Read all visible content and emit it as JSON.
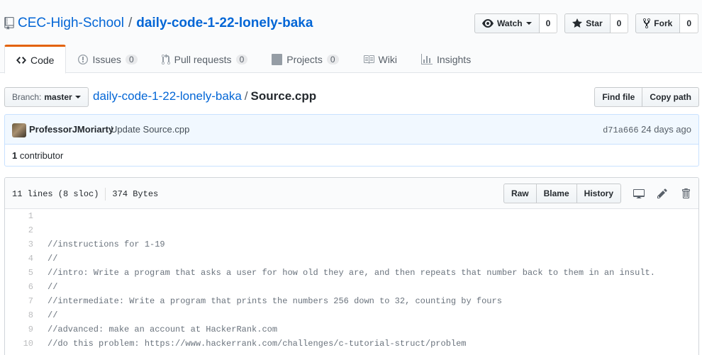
{
  "repo": {
    "owner": "CEC-High-School",
    "separator": "/",
    "name": "daily-code-1-22-lonely-baka"
  },
  "actions": {
    "watch": {
      "label": "Watch",
      "count": "0"
    },
    "star": {
      "label": "Star",
      "count": "0"
    },
    "fork": {
      "label": "Fork",
      "count": "0"
    }
  },
  "tabs": [
    {
      "label": "Code"
    },
    {
      "label": "Issues",
      "count": "0"
    },
    {
      "label": "Pull requests",
      "count": "0"
    },
    {
      "label": "Projects",
      "count": "0"
    },
    {
      "label": "Wiki"
    },
    {
      "label": "Insights"
    }
  ],
  "branch": {
    "prefix": "Branch:",
    "name": "master"
  },
  "breadcrumb": {
    "root": "daily-code-1-22-lonely-baka",
    "separator": "/",
    "file": "Source.cpp"
  },
  "file_nav": {
    "find_file": "Find file",
    "copy_path": "Copy path"
  },
  "commit": {
    "author": "ProfessorJMoriarty",
    "message": "Update Source.cpp",
    "sha": "d71a666",
    "age": "24 days ago"
  },
  "contributors": {
    "count": "1",
    "label": "contributor"
  },
  "file": {
    "lines": "11 lines (8 sloc)",
    "size": "374 Bytes",
    "raw": "Raw",
    "blame": "Blame",
    "history": "History"
  },
  "code_lines": [
    {
      "num": "1",
      "text": ""
    },
    {
      "num": "2",
      "text": ""
    },
    {
      "num": "3",
      "text": "//instructions for 1-19"
    },
    {
      "num": "4",
      "text": "//"
    },
    {
      "num": "5",
      "text": "//intro: Write a program that asks a user for how old they are, and then repeats that number back to them in an insult."
    },
    {
      "num": "6",
      "text": "//"
    },
    {
      "num": "7",
      "text": "//intermediate: Write a program that prints the numbers 256 down to 32, counting by fours"
    },
    {
      "num": "8",
      "text": "//"
    },
    {
      "num": "9",
      "text": "//advanced: make an account at HackerRank.com"
    },
    {
      "num": "10",
      "text": "//do this problem: https://www.hackerrank.com/challenges/c-tutorial-struct/problem"
    }
  ],
  "colors": {
    "link": "#0366d6",
    "tab_accent": "#e36209",
    "commit_bg": "#f1f8ff"
  }
}
